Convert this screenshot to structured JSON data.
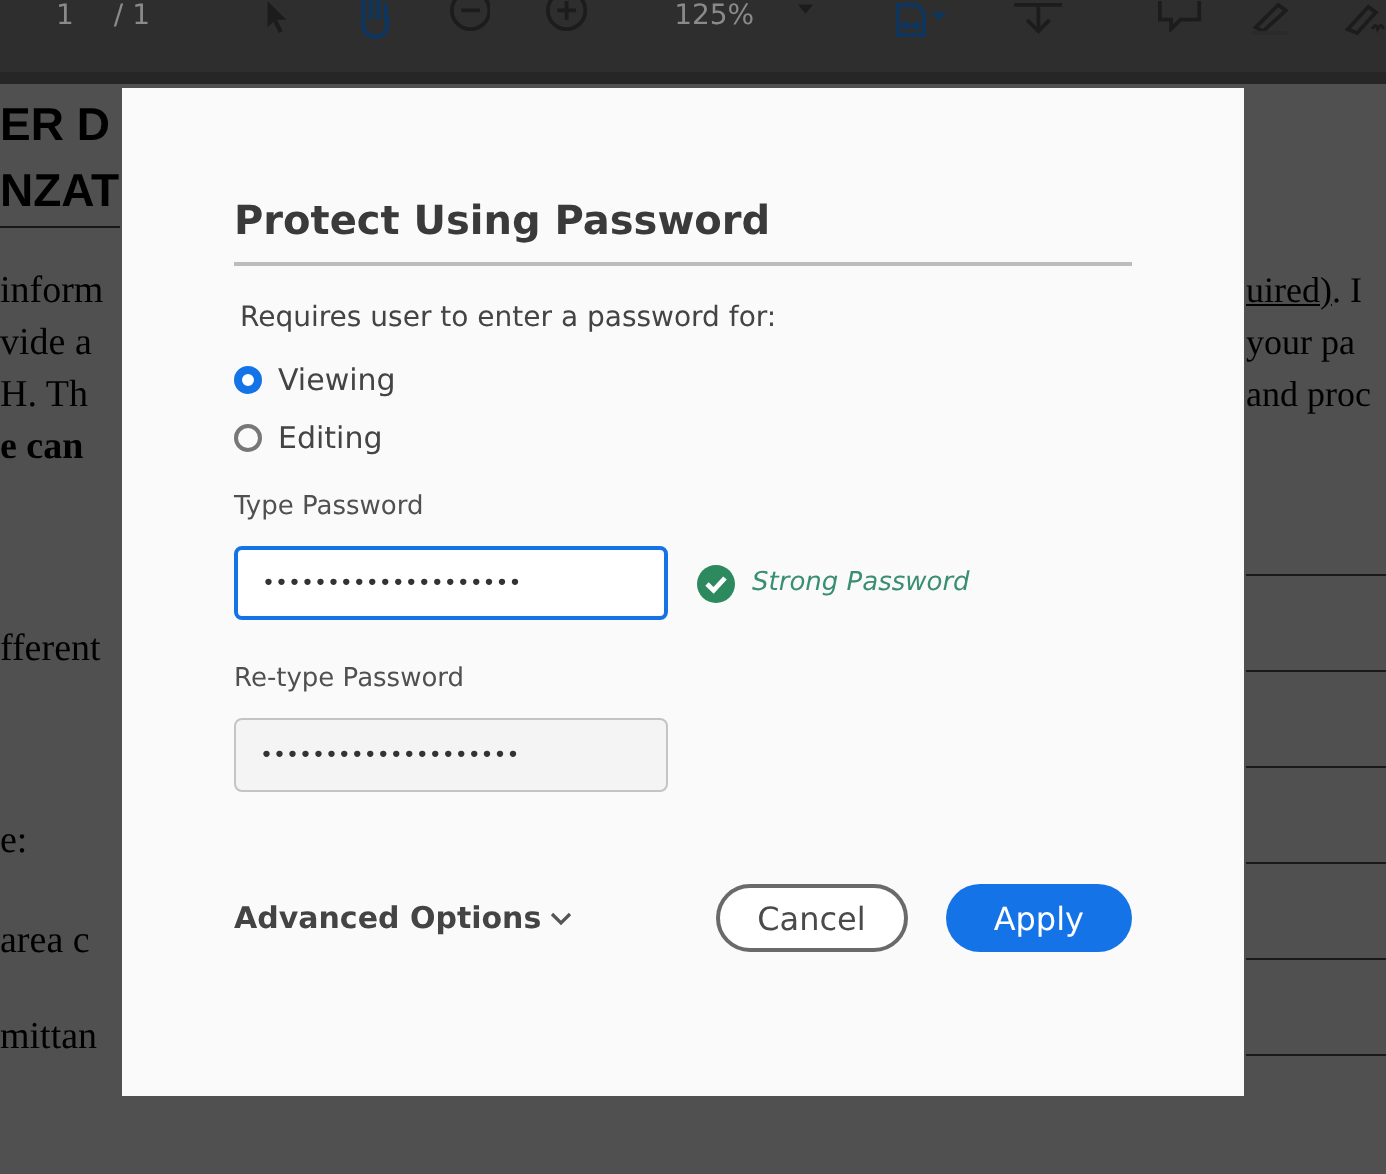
{
  "toolbar": {
    "page_number": "1",
    "page_total": "/ 1",
    "zoom": "125%"
  },
  "document": {
    "heading_fragments": [
      "ER D",
      "NZAT"
    ],
    "left_fragments": [
      {
        "text": "inform",
        "bold": false
      },
      {
        "text": "vide a",
        "bold": false
      },
      {
        "text": "H. Th",
        "bold": false
      },
      {
        "text": "e can",
        "bold": true
      },
      {
        "text": "fferent",
        "bold": false
      },
      {
        "text": "e:",
        "bold": false
      },
      {
        "text": "area c",
        "bold": false
      },
      {
        "text": "mittan",
        "bold": false
      }
    ],
    "right_fragments": [
      {
        "parts": [
          {
            "text": "uired)",
            "underlined": true
          },
          {
            "text": ". I",
            "underlined": false
          }
        ]
      },
      {
        "parts": [
          {
            "text": "your pa",
            "underlined": false
          }
        ]
      },
      {
        "parts": [
          {
            "text": "and proc",
            "underlined": false
          }
        ]
      }
    ]
  },
  "dialog": {
    "title": "Protect Using Password",
    "prompt": "Requires user to enter a password for:",
    "options": [
      {
        "label": "Viewing",
        "selected": true
      },
      {
        "label": "Editing",
        "selected": false
      }
    ],
    "fields": [
      {
        "label": "Type Password",
        "value": "••••••••••••••••••••",
        "focused": true,
        "strength": "Strong Password"
      },
      {
        "label": "Re-type Password",
        "value": "••••••••••••••••••••",
        "focused": false
      }
    ],
    "advanced": "Advanced Options",
    "buttons": [
      {
        "label": "Cancel",
        "kind": "secondary"
      },
      {
        "label": "Apply",
        "kind": "primary"
      }
    ]
  }
}
